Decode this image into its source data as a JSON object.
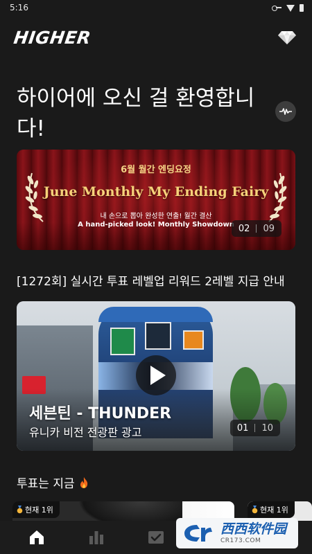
{
  "status_bar": {
    "time": "5:16"
  },
  "header": {
    "logo": "HIGHER"
  },
  "welcome": {
    "title": "하이어에 오신 걸 환영합니다!"
  },
  "banner": {
    "subtitle_top": "6월 월간 엔딩요정",
    "title": "June Monthly My Ending Fairy",
    "line1": "내 손으로 뽑아 완성한 연출! 월간 결산",
    "line2": "A hand-picked look! Monthly Showdown",
    "pager": {
      "current": "02",
      "total": "09"
    }
  },
  "episode": {
    "title": "[1272회] 실시간 투표 레벨업 리워드 2레벨 지급 안내"
  },
  "video": {
    "title": "세븐틴 - THUNDER",
    "subtitle": "유니카 비전 전광판 광고",
    "pager": {
      "current": "01",
      "total": "10"
    }
  },
  "vote_section": {
    "heading": "투표는 지금",
    "cards": [
      {
        "badge": "현재 1위"
      },
      {
        "badge": "현재 1위"
      }
    ]
  },
  "bottom_nav": {
    "items": [
      {
        "icon": "home-icon",
        "active": true
      },
      {
        "icon": "chart-icon",
        "active": false
      },
      {
        "icon": "vote-check-icon",
        "active": false
      }
    ]
  },
  "watermark": {
    "text": "西西软件园",
    "url": "CR173.COM"
  },
  "colors": {
    "background": "#1a1a1a",
    "banner_gold": "#f7d27a",
    "nav_active": "#ffffff",
    "nav_inactive": "#5a5a5a"
  }
}
